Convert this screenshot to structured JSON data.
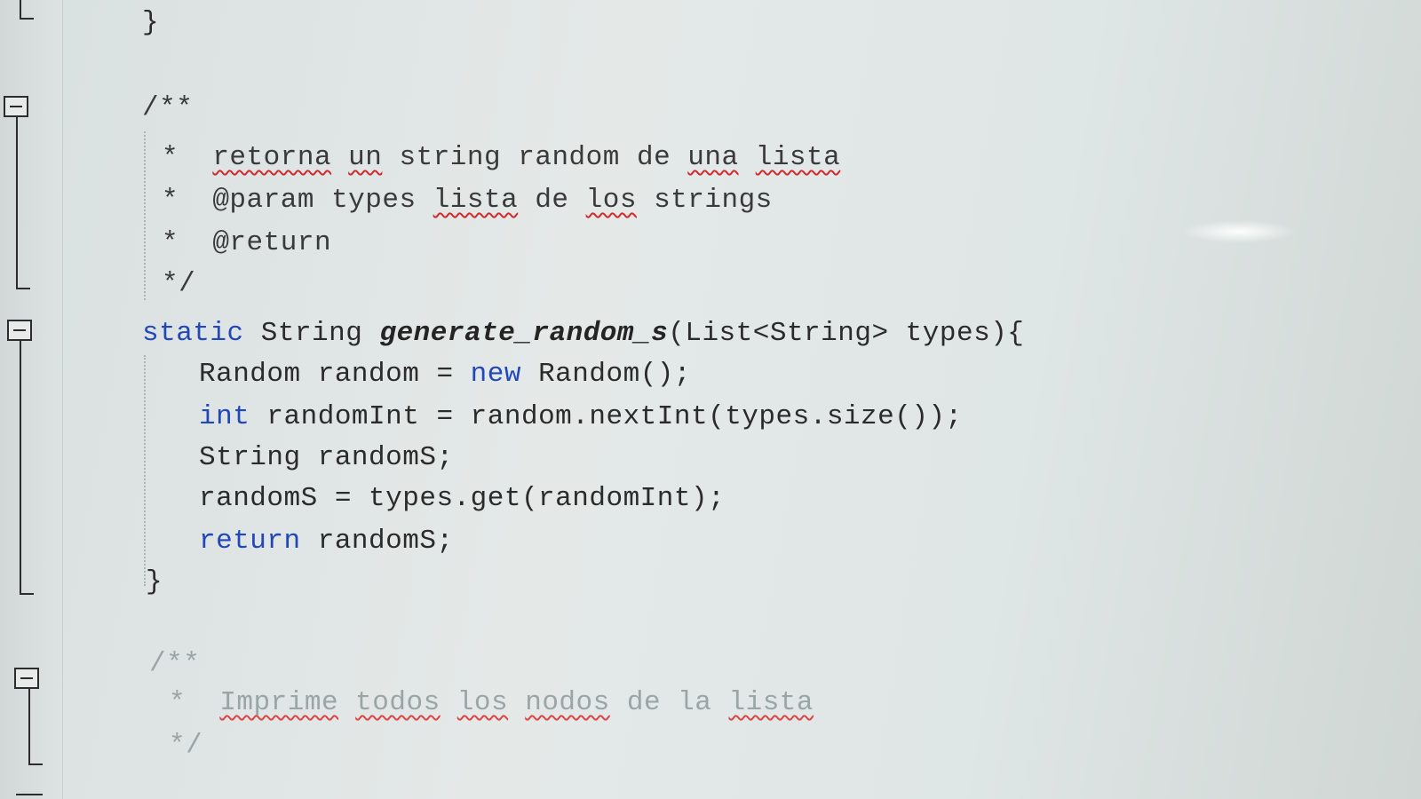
{
  "code": {
    "closing_brace_top": "}",
    "doc1": {
      "open": "/**",
      "star": "*",
      "line1": [
        "retorna",
        "un",
        "string",
        "random",
        "de",
        "una",
        "lista"
      ],
      "line2": [
        "@param",
        "types",
        "lista",
        "de",
        "los",
        "strings"
      ],
      "line3": "@return",
      "close": "*/"
    },
    "method": {
      "kw_static": "static",
      "return_type": "String",
      "name": "generate_random_s",
      "params": "(List<String> types){",
      "l1_a": "Random random = ",
      "l1_kw": "new",
      "l1_b": " Random();",
      "l2_kw": "int",
      "l2_b": " randomInt = random.nextInt(types.size());",
      "l3": "String randomS;",
      "l4": "randomS = types.get(randomInt);",
      "l5_kw": "return",
      "l5_b": " randomS;",
      "close": "}"
    },
    "doc2": {
      "open": "/**",
      "star": "*",
      "words": [
        "Imprime",
        "todos",
        "los",
        "nodos",
        "de",
        "la",
        "lista"
      ],
      "close": "*/"
    }
  },
  "colors": {
    "keyword": "#2247b8",
    "text": "#2b2b2b",
    "spellcheck": "#d12a2a"
  }
}
